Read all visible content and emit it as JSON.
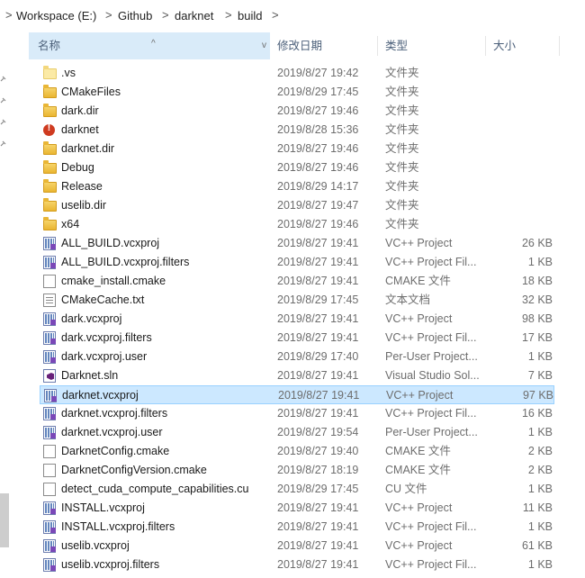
{
  "breadcrumb": [
    "Workspace (E:)",
    "Github",
    "darknet",
    "build"
  ],
  "breadcrumb_separator": ">",
  "columns": {
    "name": "名称",
    "date": "修改日期",
    "type": "类型",
    "size": "大小"
  },
  "sort_indicator": "^",
  "dropdown_indicator": "v",
  "files": [
    {
      "name": ".vs",
      "date": "2019/8/27 19:42",
      "type": "文件夹",
      "size": "",
      "icon": "folder-pale-icon"
    },
    {
      "name": "CMakeFiles",
      "date": "2019/8/29 17:45",
      "type": "文件夹",
      "size": "",
      "icon": "folder-icon"
    },
    {
      "name": "dark.dir",
      "date": "2019/8/27 19:46",
      "type": "文件夹",
      "size": "",
      "icon": "folder-icon"
    },
    {
      "name": "darknet",
      "date": "2019/8/28 15:36",
      "type": "文件夹",
      "size": "",
      "icon": "error-app-icon"
    },
    {
      "name": "darknet.dir",
      "date": "2019/8/27 19:46",
      "type": "文件夹",
      "size": "",
      "icon": "folder-icon"
    },
    {
      "name": "Debug",
      "date": "2019/8/27 19:46",
      "type": "文件夹",
      "size": "",
      "icon": "folder-icon"
    },
    {
      "name": "Release",
      "date": "2019/8/29 14:17",
      "type": "文件夹",
      "size": "",
      "icon": "folder-icon"
    },
    {
      "name": "uselib.dir",
      "date": "2019/8/27 19:47",
      "type": "文件夹",
      "size": "",
      "icon": "folder-icon"
    },
    {
      "name": "x64",
      "date": "2019/8/27 19:46",
      "type": "文件夹",
      "size": "",
      "icon": "folder-icon"
    },
    {
      "name": "ALL_BUILD.vcxproj",
      "date": "2019/8/27 19:41",
      "type": "VC++ Project",
      "size": "26 KB",
      "icon": "vcxproj-icon"
    },
    {
      "name": "ALL_BUILD.vcxproj.filters",
      "date": "2019/8/27 19:41",
      "type": "VC++ Project Fil...",
      "size": "1 KB",
      "icon": "vcxproj-icon"
    },
    {
      "name": "cmake_install.cmake",
      "date": "2019/8/27 19:41",
      "type": "CMAKE 文件",
      "size": "18 KB",
      "icon": "document-icon"
    },
    {
      "name": "CMakeCache.txt",
      "date": "2019/8/29 17:45",
      "type": "文本文档",
      "size": "32 KB",
      "icon": "text-file-icon"
    },
    {
      "name": "dark.vcxproj",
      "date": "2019/8/27 19:41",
      "type": "VC++ Project",
      "size": "98 KB",
      "icon": "vcxproj-icon"
    },
    {
      "name": "dark.vcxproj.filters",
      "date": "2019/8/27 19:41",
      "type": "VC++ Project Fil...",
      "size": "17 KB",
      "icon": "vcxproj-icon"
    },
    {
      "name": "dark.vcxproj.user",
      "date": "2019/8/29 17:40",
      "type": "Per-User Project...",
      "size": "1 KB",
      "icon": "vcxproj-icon"
    },
    {
      "name": "Darknet.sln",
      "date": "2019/8/27 19:41",
      "type": "Visual Studio Sol...",
      "size": "7 KB",
      "icon": "solution-icon"
    },
    {
      "name": "darknet.vcxproj",
      "date": "2019/8/27 19:41",
      "type": "VC++ Project",
      "size": "97 KB",
      "icon": "vcxproj-icon",
      "selected": true
    },
    {
      "name": "darknet.vcxproj.filters",
      "date": "2019/8/27 19:41",
      "type": "VC++ Project Fil...",
      "size": "16 KB",
      "icon": "vcxproj-icon"
    },
    {
      "name": "darknet.vcxproj.user",
      "date": "2019/8/27 19:54",
      "type": "Per-User Project...",
      "size": "1 KB",
      "icon": "vcxproj-icon"
    },
    {
      "name": "DarknetConfig.cmake",
      "date": "2019/8/27 19:40",
      "type": "CMAKE 文件",
      "size": "2 KB",
      "icon": "document-icon"
    },
    {
      "name": "DarknetConfigVersion.cmake",
      "date": "2019/8/27 18:19",
      "type": "CMAKE 文件",
      "size": "2 KB",
      "icon": "document-icon"
    },
    {
      "name": "detect_cuda_compute_capabilities.cu",
      "date": "2019/8/29 17:45",
      "type": "CU 文件",
      "size": "1 KB",
      "icon": "document-icon"
    },
    {
      "name": "INSTALL.vcxproj",
      "date": "2019/8/27 19:41",
      "type": "VC++ Project",
      "size": "11 KB",
      "icon": "vcxproj-icon"
    },
    {
      "name": "INSTALL.vcxproj.filters",
      "date": "2019/8/27 19:41",
      "type": "VC++ Project Fil...",
      "size": "1 KB",
      "icon": "vcxproj-icon"
    },
    {
      "name": "uselib.vcxproj",
      "date": "2019/8/27 19:41",
      "type": "VC++ Project",
      "size": "61 KB",
      "icon": "vcxproj-icon"
    },
    {
      "name": "uselib.vcxproj.filters",
      "date": "2019/8/27 19:41",
      "type": "VC++ Project Fil...",
      "size": "1 KB",
      "icon": "vcxproj-icon"
    }
  ],
  "colors": {
    "selection": "#cce8ff",
    "selection_border": "#99d1ff",
    "header_sorted": "#d9ebf9",
    "header_text": "#4c607a"
  }
}
